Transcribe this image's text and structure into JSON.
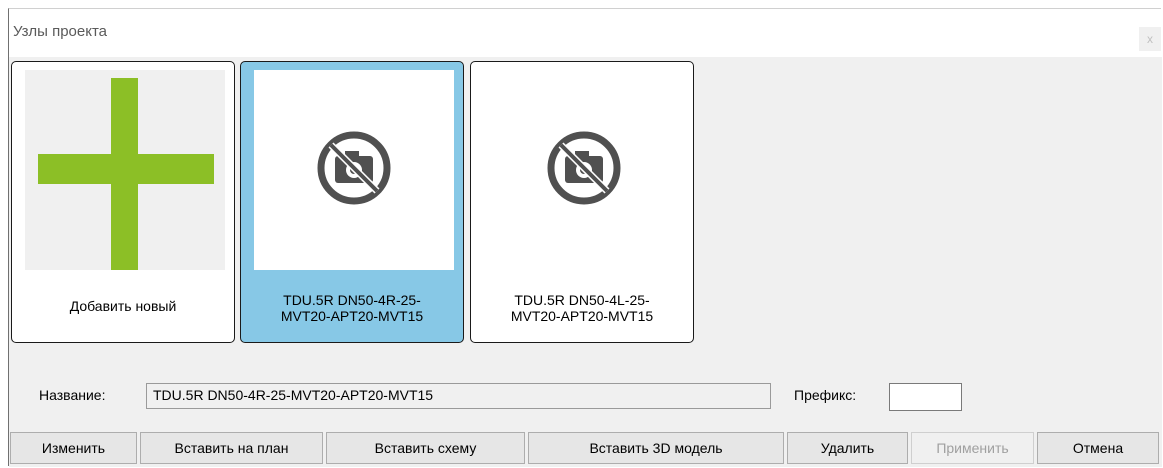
{
  "window": {
    "title": "Узлы проекта",
    "close_label": "x"
  },
  "tiles": [
    {
      "caption_line1": "Добавить новый",
      "caption_line2": "",
      "icon": "plus-icon",
      "selected": false
    },
    {
      "caption_line1": "TDU.5R DN50-4R-25-",
      "caption_line2": "MVT20-APT20-MVT15",
      "icon": "no-photo-icon",
      "selected": true
    },
    {
      "caption_line1": "TDU.5R DN50-4L-25-",
      "caption_line2": "MVT20-APT20-MVT15",
      "icon": "no-photo-icon",
      "selected": false
    }
  ],
  "form": {
    "name_label": "Название:",
    "name_value": "TDU.5R DN50-4R-25-MVT20-APT20-MVT15",
    "prefix_label": "Префикс:",
    "prefix_value": ""
  },
  "buttons": {
    "edit": "Изменить",
    "insert_plan": "Вставить на план",
    "insert_scheme": "Вставить схему",
    "insert_3d": "Вставить 3D модель",
    "delete": "Удалить",
    "apply": "Применить",
    "cancel": "Отмена"
  },
  "colors": {
    "accent_selected": "#87c8e6",
    "plus_green": "#8cbf26",
    "no_photo_gray": "#505050"
  }
}
